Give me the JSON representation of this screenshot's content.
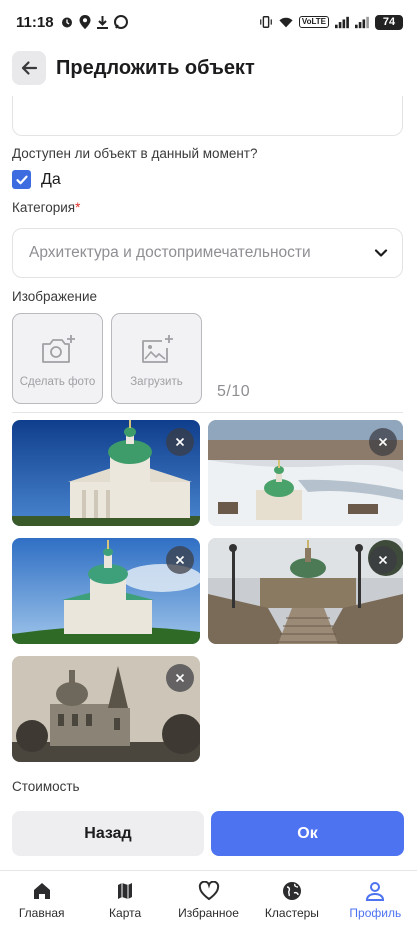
{
  "status_bar": {
    "time": "11:18",
    "volte": "VoLTE",
    "battery": "74"
  },
  "header": {
    "title": "Предложить объект"
  },
  "form": {
    "availability_question": "Доступен ли объект в данный момент?",
    "availability_checked": true,
    "availability_option": "Да",
    "category_label": "Категория",
    "category_required_mark": "*",
    "category_value": "Архитектура и достопримечательности",
    "image_label": "Изображение",
    "take_photo_label": "Сделать фото",
    "upload_label": "Загрузить",
    "image_counter": "5/10",
    "photos": [
      {
        "alt": "church-photo-1"
      },
      {
        "alt": "church-photo-2"
      },
      {
        "alt": "church-photo-3"
      },
      {
        "alt": "church-photo-4"
      },
      {
        "alt": "church-photo-5"
      }
    ],
    "cost_label": "Стоимость"
  },
  "actions": {
    "back_label": "Назад",
    "ok_label": "Ок"
  },
  "bottom_nav": {
    "items": [
      {
        "label": "Главная",
        "icon": "home-icon"
      },
      {
        "label": "Карта",
        "icon": "map-icon"
      },
      {
        "label": "Избранное",
        "icon": "heart-icon"
      },
      {
        "label": "Кластеры",
        "icon": "globe-icon"
      },
      {
        "label": "Профиль",
        "icon": "profile-icon"
      }
    ],
    "active_index": 4
  },
  "colors": {
    "accent": "#4d73f0",
    "checkbox": "#3d6be0",
    "required": "#e0312a"
  }
}
